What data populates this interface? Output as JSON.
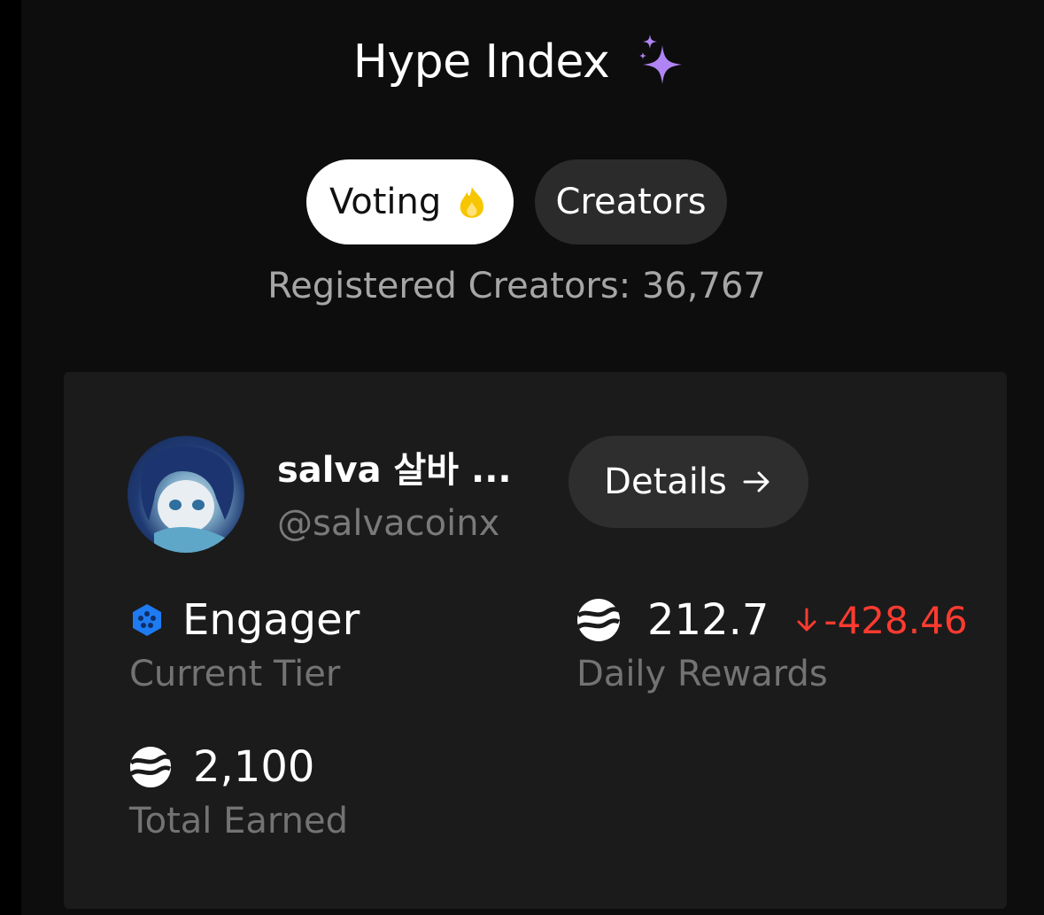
{
  "header": {
    "title": "Hype Index",
    "title_icon": "sparkles-icon"
  },
  "tabs": [
    {
      "label": "Voting",
      "icon": "flame-icon",
      "active": true
    },
    {
      "label": "Creators",
      "active": false
    }
  ],
  "registered_text": "Registered Creators: 36,767",
  "creator_card": {
    "name": "salva 살바 ...",
    "handle": "@salvacoinx",
    "details_label": "Details",
    "details_icon": "arrow-right-icon",
    "tier": {
      "value": "Engager",
      "label": "Current Tier",
      "icon": "hexagon-badge-icon"
    },
    "daily_rewards": {
      "value": "212.7",
      "change": "-428.46",
      "label": "Daily Rewards",
      "icon": "coin-icon",
      "change_icon": "arrow-down-icon"
    },
    "total_earned": {
      "value": "2,100",
      "label": "Total Earned",
      "icon": "coin-icon"
    }
  },
  "colors": {
    "background": "#0d0d0d",
    "card": "#1b1b1b",
    "accent_purple": "#b084f5",
    "negative": "#ff3b30",
    "tier_blue": "#1e7bf2",
    "flame_yellow": "#f7c600"
  }
}
